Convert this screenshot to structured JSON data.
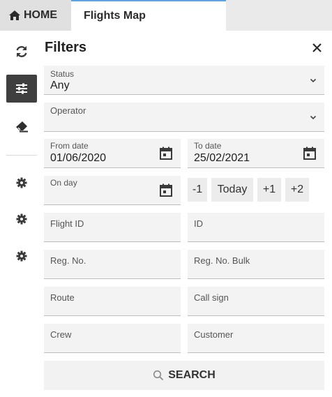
{
  "tabs": {
    "home_label": "HOME",
    "map_label": "Flights Map"
  },
  "sidebar": {
    "items": [
      {
        "icon": "refresh-icon"
      },
      {
        "icon": "sliders-icon",
        "active": true
      },
      {
        "icon": "eraser-icon"
      },
      {
        "icon": "gear-icon"
      },
      {
        "icon": "gear-icon"
      },
      {
        "icon": "gear-icon"
      }
    ]
  },
  "panel": {
    "title": "Filters",
    "close_icon": "close-icon"
  },
  "filters": {
    "status": {
      "label": "Status",
      "value": "Any"
    },
    "operator": {
      "label": "Operator",
      "value": ""
    },
    "from_date": {
      "label": "From date",
      "value": "01/06/2020"
    },
    "to_date": {
      "label": "To date",
      "value": "25/02/2021"
    },
    "on_day": {
      "label": "On day",
      "value": ""
    },
    "flight_id": {
      "placeholder": "Flight ID"
    },
    "id": {
      "placeholder": "ID"
    },
    "reg_no": {
      "placeholder": "Reg. No."
    },
    "reg_no_bulk": {
      "placeholder": "Reg. No. Bulk"
    },
    "route": {
      "placeholder": "Route"
    },
    "call_sign": {
      "placeholder": "Call sign"
    },
    "crew": {
      "placeholder": "Crew"
    },
    "customer": {
      "placeholder": "Customer"
    }
  },
  "day_buttons": {
    "minus1": "-1",
    "today": "Today",
    "plus1": "+1",
    "plus2": "+2"
  },
  "search": {
    "label": "SEARCH"
  },
  "colors": {
    "active_tab_accent": "#5aa4e6",
    "active_sidebar": "#3f3f3f",
    "field_bg": "#f3f3f3"
  }
}
